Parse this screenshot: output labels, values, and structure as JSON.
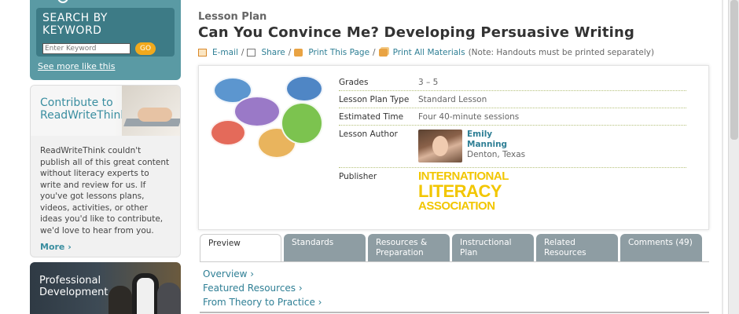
{
  "sidebar": {
    "search": {
      "title": "SEARCH BY KEYWORD",
      "placeholder": "Enter Keyword",
      "go_label": "GO",
      "see_more": "See more like this"
    },
    "contribute": {
      "title_line1": "Contribute to",
      "title_line2": "ReadWriteThink",
      "body": "ReadWriteThink couldn't publish all of this great content without literacy experts to write and review for us. If you've got lessons plans, videos, activities, or other ideas you'd like to contribute, we'd love to hear from you.",
      "more": "More ›"
    },
    "professional": {
      "title_line1": "Professional",
      "title_line2": "Development"
    }
  },
  "main": {
    "label": "Lesson Plan",
    "title": "Can You Convince Me? Developing Persuasive Writing",
    "actions": {
      "email": "E-mail",
      "share": "Share",
      "print": "Print This Page",
      "print_all": "Print All Materials",
      "note": "(Note: Handouts must be printed separately)",
      "sep": "/"
    },
    "info": {
      "grades_label": "Grades",
      "grades_value": "3 – 5",
      "type_label": "Lesson Plan Type",
      "type_value": "Standard Lesson",
      "time_label": "Estimated Time",
      "time_value": "Four 40-minute sessions",
      "author_label": "Lesson Author",
      "author_first": "Emily",
      "author_last": "Manning",
      "author_location": "Denton, Texas",
      "publisher_label": "Publisher",
      "publisher_line1": "INTERNATIONAL",
      "publisher_line2": "LITERACY",
      "publisher_line3": "ASSOCIATION"
    },
    "tabs": [
      {
        "label": "Preview"
      },
      {
        "label": "Standards"
      },
      {
        "label": "Resources & Preparation"
      },
      {
        "label": "Instructional Plan"
      },
      {
        "label": "Related Resources"
      },
      {
        "label": "Comments (49)"
      }
    ],
    "sublinks": {
      "overview": "Overview ›",
      "featured": "Featured Resources ›",
      "theory": "From Theory to Practice ›"
    }
  },
  "colors": {
    "teal": "#5a9aa4",
    "link": "#2f7f95",
    "tab_gray": "#8e9da3",
    "go_orange": "#f1a91c",
    "ila_yellow": "#f2c600"
  }
}
